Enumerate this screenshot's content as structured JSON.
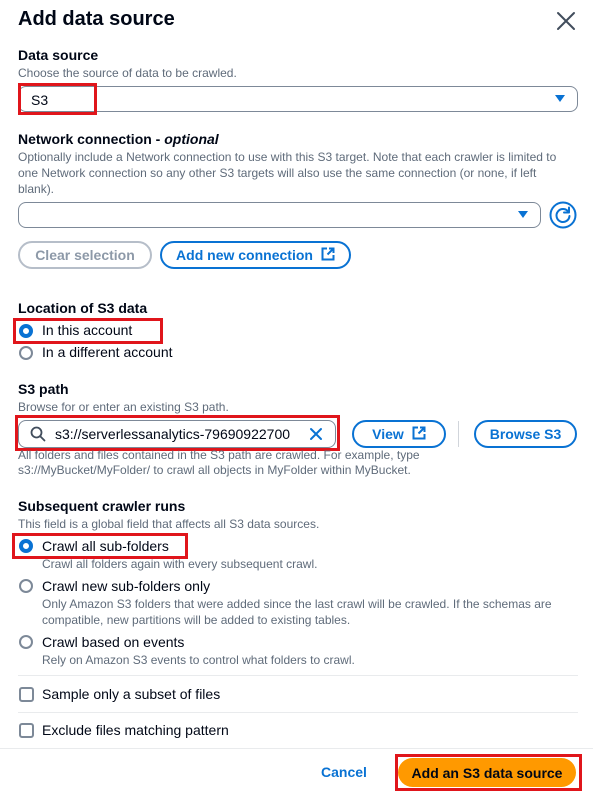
{
  "modal": {
    "title": "Add data source"
  },
  "data_source": {
    "label": "Data source",
    "description": "Choose the source of data to be crawled.",
    "selected": "S3"
  },
  "network": {
    "label_main": "Network connection - ",
    "label_optional": "optional",
    "description": "Optionally include a Network connection to use with this S3 target. Note that each crawler is limited to one Network connection so any other S3 targets will also use the same connection (or none, if left blank).",
    "selected": "",
    "clear_label": "Clear selection",
    "add_label": "Add new connection"
  },
  "location": {
    "label": "Location of S3 data",
    "options": [
      "In this account",
      "In a different account"
    ]
  },
  "s3_path": {
    "label": "S3 path",
    "description": "Browse for or enter an existing S3 path.",
    "value": "s3://serverlessanalytics-79690922700",
    "view_label": "View",
    "browse_label": "Browse S3",
    "help_line1": "All folders and files contained in the S3 path are crawled. For example, type",
    "help_line2": "s3://MyBucket/MyFolder/ to crawl all objects in MyFolder within MyBucket."
  },
  "crawler_runs": {
    "label": "Subsequent crawler runs",
    "description": "This field is a global field that affects all S3 data sources.",
    "options": [
      {
        "label": "Crawl all sub-folders",
        "desc": "Crawl all folders again with every subsequent crawl."
      },
      {
        "label": "Crawl new sub-folders only",
        "desc": "Only Amazon S3 folders that were added since the last crawl will be crawled. If the schemas are compatible, new partitions will be added to existing tables."
      },
      {
        "label": "Crawl based on events",
        "desc": "Rely on Amazon S3 events to control what folders to crawl."
      }
    ]
  },
  "checkboxes": {
    "sample": "Sample only a subset of files",
    "exclude": "Exclude files matching pattern"
  },
  "footer": {
    "cancel": "Cancel",
    "submit": "Add an S3 data source"
  },
  "colors": {
    "accent": "#0972d3",
    "primary_button": "#ff9900",
    "highlight": "#e0151b"
  }
}
